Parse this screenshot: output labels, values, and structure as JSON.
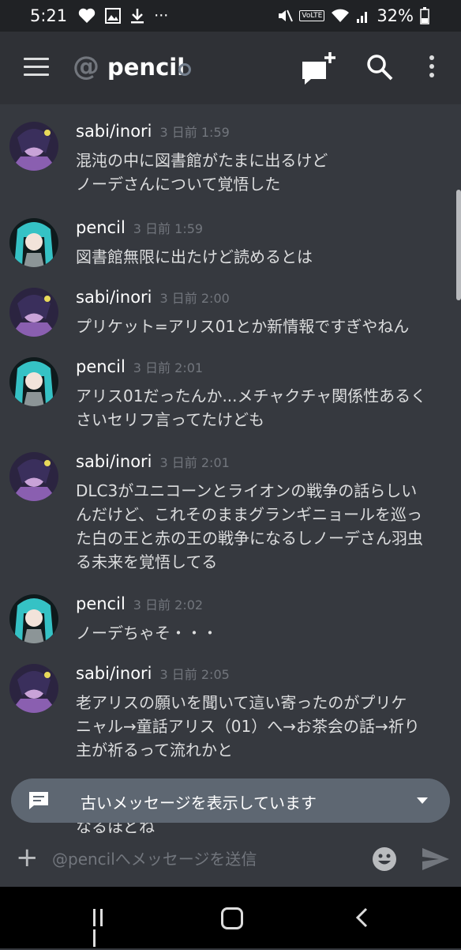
{
  "status_bar": {
    "time": "5:21",
    "left_icons": [
      "heart-icon",
      "image-icon",
      "download-icon",
      "more-notifications-icon"
    ],
    "volte_label": "VoLTE",
    "battery": "32%"
  },
  "header": {
    "channel_name": "pencil",
    "icons": [
      "menu-icon",
      "at-icon",
      "new-dm-icon",
      "search-icon",
      "more-vertical-icon"
    ]
  },
  "messages": [
    {
      "author": "sabi/inori",
      "timestamp": "3 日前 1:59",
      "lines": [
        "混沌の中に図書館がたまに出るけど",
        "ノーデさんについて覚悟した"
      ]
    },
    {
      "author": "pencil",
      "timestamp": "3 日前 1:59",
      "lines": [
        "図書館無限に出たけど読めるとは"
      ]
    },
    {
      "author": "sabi/inori",
      "timestamp": "3 日前 2:00",
      "lines": [
        "プリケット=アリス01とか新情報ですぎやねん"
      ]
    },
    {
      "author": "pencil",
      "timestamp": "3 日前 2:01",
      "lines": [
        "アリス01だったんか...メチャクチャ関係性あるく",
        "さいセリフ言ってたけども"
      ]
    },
    {
      "author": "sabi/inori",
      "timestamp": "3 日前 2:01",
      "lines": [
        "DLC3がユニコーンとライオンの戦争の話らしい",
        "んだけど、これそのままグランギニョールを巡っ",
        "た白の王と赤の王の戦争になるしノーデさん羽虫",
        "る未来を覚悟してる"
      ]
    },
    {
      "author": "pencil",
      "timestamp": "3 日前 2:02",
      "lines": [
        "ノーデちゃそ・・・"
      ]
    },
    {
      "author": "sabi/inori",
      "timestamp": "3 日前 2:05",
      "lines": [
        "老アリスの願いを聞いて這い寄ったのがプリケ",
        "ニャル→童話アリス（01）へ→お茶会の話→祈り",
        "主が祈るって流れかと"
      ]
    }
  ],
  "old_messages_banner": {
    "label": "古いメッセージを表示しています"
  },
  "peek_message": "なるほどね",
  "composer": {
    "placeholder": "@pencilへメッセージを送信"
  },
  "nav_bar": {
    "icons": [
      "recent-apps-icon",
      "home-icon",
      "back-icon"
    ]
  },
  "colors": {
    "background": "#36393f",
    "header": "#2f3136",
    "banner": "#5e6772",
    "timestamp": "#72767d"
  }
}
